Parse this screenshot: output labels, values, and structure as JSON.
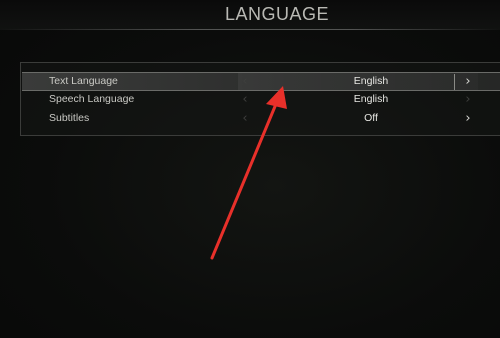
{
  "header": {
    "title": "LANGUAGE"
  },
  "settings": [
    {
      "label": "Text Language",
      "value": "English",
      "selected": true,
      "right_enabled": true
    },
    {
      "label": "Speech Language",
      "value": "English",
      "selected": false,
      "right_enabled": false
    },
    {
      "label": "Subtitles",
      "value": "Off",
      "selected": false,
      "right_enabled": true
    }
  ],
  "icons": {
    "left": "chevron-left-icon",
    "right": "chevron-right-icon"
  },
  "annotation": {
    "type": "red-arrow",
    "color": "#e8302a",
    "points_to": "Text Language value"
  }
}
